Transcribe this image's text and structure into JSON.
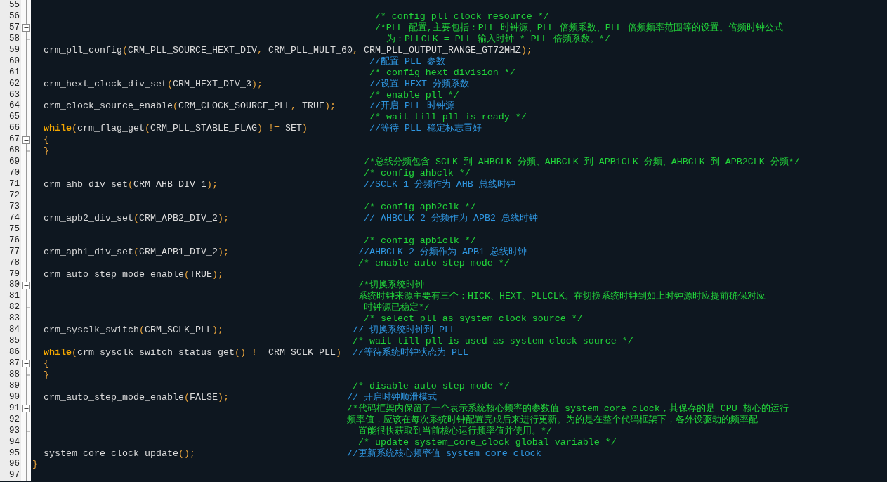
{
  "editor": {
    "lines": [
      {
        "number": "55",
        "kind": "plain"
      },
      {
        "number": "56",
        "kind": "plain",
        "comment": {
          "kind": "block",
          "text": "/* config pll clock resource */"
        }
      },
      {
        "number": "57",
        "kind": "fold-start",
        "comment": {
          "kind": "block",
          "text": "/*PLL 配置,主要包括：PLL 时钟源、PLL 倍频系数、PLL 倍频频率范围等的设置。倍频时钟公式"
        }
      },
      {
        "number": "58",
        "kind": "fold-end",
        "comment": {
          "kind": "block",
          "text": "为：PLLCLK = PLL 输入时钟 * PLL 倍频系数。*/"
        }
      },
      {
        "number": "59",
        "kind": "plain",
        "code": [
          {
            "kind": "name",
            "text": "crm_pll_config"
          },
          {
            "kind": "punct",
            "text": "("
          },
          {
            "kind": "name",
            "text": "CRM_PLL_SOURCE_HEXT_DIV"
          },
          {
            "kind": "punct",
            "text": ", "
          },
          {
            "kind": "name",
            "text": "CRM_PLL_MULT_60"
          },
          {
            "kind": "punct",
            "text": ", "
          },
          {
            "kind": "name",
            "text": "CRM_PLL_OUTPUT_RANGE_GT72MHZ"
          },
          {
            "kind": "punct",
            "text": ");"
          }
        ]
      },
      {
        "number": "60",
        "kind": "plain",
        "comment": {
          "kind": "line",
          "text": "//配置 PLL 参数"
        }
      },
      {
        "number": "61",
        "kind": "plain",
        "comment": {
          "kind": "block",
          "text": "/* config hext division */"
        }
      },
      {
        "number": "62",
        "kind": "plain",
        "code": [
          {
            "kind": "name",
            "text": "crm_hext_clock_div_set"
          },
          {
            "kind": "punct",
            "text": "("
          },
          {
            "kind": "name",
            "text": "CRM_HEXT_DIV_3"
          },
          {
            "kind": "punct",
            "text": ");"
          }
        ],
        "comment": {
          "kind": "line",
          "text": "//设置 HEXT 分频系数"
        }
      },
      {
        "number": "63",
        "kind": "plain",
        "comment": {
          "kind": "block",
          "text": "/* enable pll */"
        }
      },
      {
        "number": "64",
        "kind": "plain",
        "code": [
          {
            "kind": "name",
            "text": "crm_clock_source_enable"
          },
          {
            "kind": "punct",
            "text": "("
          },
          {
            "kind": "name",
            "text": "CRM_CLOCK_SOURCE_PLL"
          },
          {
            "kind": "punct",
            "text": ", "
          },
          {
            "kind": "name",
            "text": "TRUE"
          },
          {
            "kind": "punct",
            "text": ");"
          }
        ],
        "comment": {
          "kind": "line",
          "text": "//开启 PLL 时钟源"
        }
      },
      {
        "number": "65",
        "kind": "plain",
        "comment": {
          "kind": "block",
          "text": "/* wait till pll is ready */"
        }
      },
      {
        "number": "66",
        "kind": "plain",
        "code": [
          {
            "kind": "keyword",
            "text": "while"
          },
          {
            "kind": "punct",
            "text": "("
          },
          {
            "kind": "name",
            "text": "crm_flag_get"
          },
          {
            "kind": "punct",
            "text": "("
          },
          {
            "kind": "name",
            "text": "CRM_PLL_STABLE_FLAG"
          },
          {
            "kind": "punct",
            "text": ") != "
          },
          {
            "kind": "name",
            "text": "SET"
          },
          {
            "kind": "punct",
            "text": ")"
          }
        ],
        "comment": {
          "kind": "line",
          "text": "//等待 PLL 稳定标志置好"
        }
      },
      {
        "number": "67",
        "kind": "fold-start",
        "code": [
          {
            "kind": "punct",
            "text": "{"
          }
        ]
      },
      {
        "number": "68",
        "kind": "fold-end",
        "code": [
          {
            "kind": "punct",
            "text": "}"
          }
        ]
      },
      {
        "number": "69",
        "kind": "plain",
        "comment": {
          "kind": "block",
          "text": "/*总线分频包含 SCLK 到 AHBCLK 分频、AHBCLK 到 APB1CLK 分频、AHBCLK 到 APB2CLK 分频*/"
        }
      },
      {
        "number": "70",
        "kind": "plain",
        "comment": {
          "kind": "block",
          "text": "/* config ahbclk */"
        }
      },
      {
        "number": "71",
        "kind": "plain",
        "code": [
          {
            "kind": "name",
            "text": "crm_ahb_div_set"
          },
          {
            "kind": "punct",
            "text": "("
          },
          {
            "kind": "name",
            "text": "CRM_AHB_DIV_1"
          },
          {
            "kind": "punct",
            "text": ");"
          }
        ],
        "comment": {
          "kind": "line",
          "text": "//SCLK 1 分频作为 AHB 总线时钟"
        }
      },
      {
        "number": "72",
        "kind": "plain"
      },
      {
        "number": "73",
        "kind": "plain",
        "comment": {
          "kind": "block",
          "text": "/* config apb2clk */"
        }
      },
      {
        "number": "74",
        "kind": "plain",
        "code": [
          {
            "kind": "name",
            "text": "crm_apb2_div_set"
          },
          {
            "kind": "punct",
            "text": "("
          },
          {
            "kind": "name",
            "text": "CRM_APB2_DIV_2"
          },
          {
            "kind": "punct",
            "text": ");"
          }
        ],
        "comment": {
          "kind": "line",
          "text": "// AHBCLK 2 分频作为 APB2 总线时钟"
        }
      },
      {
        "number": "75",
        "kind": "plain"
      },
      {
        "number": "76",
        "kind": "plain",
        "comment": {
          "kind": "block",
          "text": "/* config apb1clk */"
        }
      },
      {
        "number": "77",
        "kind": "plain",
        "code": [
          {
            "kind": "name",
            "text": "crm_apb1_div_set"
          },
          {
            "kind": "punct",
            "text": "("
          },
          {
            "kind": "name",
            "text": "CRM_APB1_DIV_2"
          },
          {
            "kind": "punct",
            "text": ");"
          }
        ],
        "comment": {
          "kind": "line",
          "text": "//AHBCLK 2 分频作为 APB1 总线时钟"
        }
      },
      {
        "number": "78",
        "kind": "plain",
        "comment": {
          "kind": "block",
          "text": "/* enable auto step mode */"
        }
      },
      {
        "number": "79",
        "kind": "plain",
        "code": [
          {
            "kind": "name",
            "text": "crm_auto_step_mode_enable"
          },
          {
            "kind": "punct",
            "text": "("
          },
          {
            "kind": "name",
            "text": "TRUE"
          },
          {
            "kind": "punct",
            "text": ");"
          }
        ]
      },
      {
        "number": "80",
        "kind": "fold-start",
        "comment": {
          "kind": "block",
          "text": "/*切换系统时钟"
        }
      },
      {
        "number": "81",
        "kind": "plain",
        "comment": {
          "kind": "block",
          "text": "系统时钟来源主要有三个：HICK、HEXT、PLLCLK。在切换系统时钟到如上时钟源时应提前确保对应"
        }
      },
      {
        "number": "82",
        "kind": "fold-end",
        "comment": {
          "kind": "block",
          "text": "时钟源已稳定*/"
        }
      },
      {
        "number": "83",
        "kind": "plain",
        "comment": {
          "kind": "block",
          "text": "/* select pll as system clock source */"
        }
      },
      {
        "number": "84",
        "kind": "plain",
        "code": [
          {
            "kind": "name",
            "text": "crm_sysclk_switch"
          },
          {
            "kind": "punct",
            "text": "("
          },
          {
            "kind": "name",
            "text": "CRM_SCLK_PLL"
          },
          {
            "kind": "punct",
            "text": ");"
          }
        ],
        "comment": {
          "kind": "line",
          "text": "// 切换系统时钟到 PLL"
        }
      },
      {
        "number": "85",
        "kind": "plain",
        "comment": {
          "kind": "block",
          "text": "/* wait till pll is used as system clock source */"
        }
      },
      {
        "number": "86",
        "kind": "plain",
        "code": [
          {
            "kind": "keyword",
            "text": "while"
          },
          {
            "kind": "punct",
            "text": "("
          },
          {
            "kind": "name",
            "text": "crm_sysclk_switch_status_get"
          },
          {
            "kind": "punct",
            "text": "() != "
          },
          {
            "kind": "name",
            "text": "CRM_SCLK_PLL"
          },
          {
            "kind": "punct",
            "text": ")"
          }
        ],
        "comment": {
          "kind": "line",
          "text": "//等待系统时钟状态为 PLL"
        }
      },
      {
        "number": "87",
        "kind": "fold-start",
        "code": [
          {
            "kind": "punct",
            "text": "{"
          }
        ]
      },
      {
        "number": "88",
        "kind": "fold-end",
        "code": [
          {
            "kind": "punct",
            "text": "}"
          }
        ]
      },
      {
        "number": "89",
        "kind": "plain",
        "comment": {
          "kind": "block",
          "text": "/* disable auto step mode */"
        }
      },
      {
        "number": "90",
        "kind": "plain",
        "code": [
          {
            "kind": "name",
            "text": "crm_auto_step_mode_enable"
          },
          {
            "kind": "punct",
            "text": "("
          },
          {
            "kind": "name",
            "text": "FALSE"
          },
          {
            "kind": "punct",
            "text": ");"
          }
        ],
        "comment": {
          "kind": "line",
          "text": "// 开启时钟顺滑模式"
        }
      },
      {
        "number": "91",
        "kind": "fold-start",
        "comment": {
          "kind": "block",
          "text": "/*代码框架内保留了一个表示系统核心频率的参数值 system_core_clock，其保存的是 CPU 核心的运行"
        }
      },
      {
        "number": "92",
        "kind": "plain",
        "comment": {
          "kind": "block",
          "text": "频率值，应该在每次系统时钟配置完成后来进行更新。为的是在整个代码框架下，各外设驱动的频率配"
        }
      },
      {
        "number": "93",
        "kind": "fold-end",
        "comment": {
          "kind": "block",
          "text": "置能很快获取到当前核心运行频率值并使用。*/"
        }
      },
      {
        "number": "94",
        "kind": "plain",
        "comment": {
          "kind": "block",
          "text": "/* update system_core_clock global variable */"
        }
      },
      {
        "number": "95",
        "kind": "plain",
        "code": [
          {
            "kind": "name",
            "text": "system_core_clock_update"
          },
          {
            "kind": "punct",
            "text": "();"
          }
        ],
        "comment": {
          "kind": "line",
          "text": "//更新系统核心频率值 system_core_clock"
        }
      },
      {
        "number": "96",
        "kind": "plain",
        "code": [
          {
            "kind": "punct",
            "text": "}"
          }
        ]
      },
      {
        "number": "97",
        "kind": "plain"
      }
    ]
  }
}
